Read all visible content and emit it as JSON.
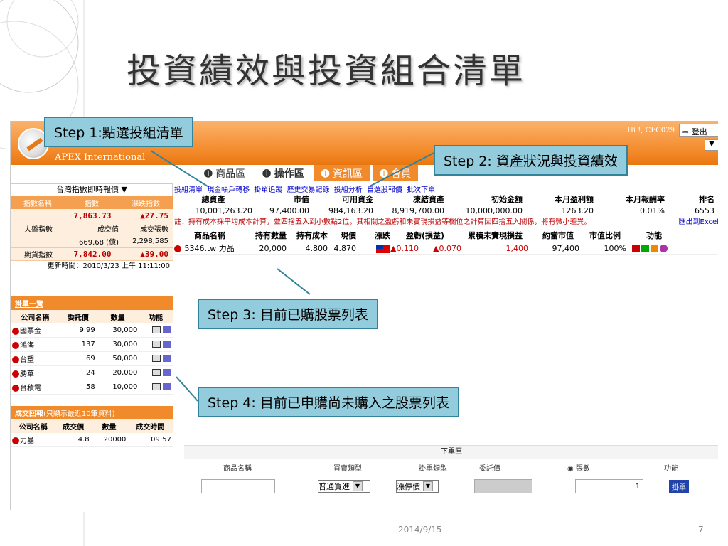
{
  "slide": {
    "title": "投資績效與投資組合清單",
    "date": "2014/9/15",
    "page_number": "7"
  },
  "app": {
    "brand": "APEX International",
    "greeting": "Hi !, CFC029",
    "logout_label": "登出",
    "dropdown_arrow": "▼",
    "nav_tabs": [
      "商品區",
      "操作區",
      "資訊區",
      "會員"
    ],
    "nav_icon": "circle-arrow-icon",
    "accent_color": "#f08a2a"
  },
  "left": {
    "quote_select": "台灣指數即時報價",
    "index_header": [
      "指數名稱",
      "指數",
      "漲跌指數"
    ],
    "market": {
      "name": "大盤指數",
      "index": "7,863.73",
      "change": "▲27.75",
      "volume_label": "成交值",
      "volume": "669.68 (億)",
      "sheets_label": "成交張數",
      "sheets": "2,298,585"
    },
    "futures": {
      "name": "期貨指數",
      "index": "7,842.00",
      "change": "▲39.00"
    },
    "update_time": "更新時間：2010/3/23 上午 11:11:00",
    "pending": {
      "title": "掛單一覽",
      "headers": [
        "公司名稱",
        "委託價",
        "數量",
        "功能"
      ],
      "rows": [
        {
          "name": "國票金",
          "price": "9.99",
          "qty": "30,000"
        },
        {
          "name": "鴻海",
          "price": "137",
          "qty": "30,000"
        },
        {
          "name": "台塑",
          "price": "69",
          "qty": "50,000"
        },
        {
          "name": "勝華",
          "price": "24",
          "qty": "20,000"
        },
        {
          "name": "台積電",
          "price": "58",
          "qty": "10,000"
        }
      ]
    },
    "trades": {
      "title": "成交回報",
      "subtitle": "(只顯示最近10筆資料)",
      "headers": [
        "公司名稱",
        "成交價",
        "數量",
        "成交時間"
      ],
      "rows": [
        {
          "name": "力晶",
          "price": "4.8",
          "qty": "20000",
          "time": "09:57"
        }
      ]
    }
  },
  "main": {
    "links": [
      "投組清單",
      "現金帳戶轉移",
      "掛單追蹤",
      "歷史交易記錄",
      "投組分析",
      "自選股報價",
      "批次下單"
    ],
    "summary_headers": [
      "總資產",
      "市值",
      "可用資金",
      "凍結資產",
      "初始金額",
      "本月盈利額",
      "本月報酬率",
      "排名"
    ],
    "summary_values": [
      "10,001,263.20",
      "97,400.00",
      "984,163.20",
      "8,919,700.00",
      "10,000,000.00",
      "1263.20",
      "0.01%",
      "6553"
    ],
    "note": "註：持有成本採平均成本計算，並四捨五入到小數點2位。其相關之盈虧和未實現損益等欄位之計算因四捨五入關係，將有微小差異。",
    "export_label": "匯出到Excel",
    "holdings_headers": [
      "商品名稱",
      "持有數量",
      "持有成本",
      "現價",
      "漲跌",
      "盈虧(損益)",
      "累積未實現損益",
      "約當市值",
      "市值比例",
      "功能"
    ],
    "holdings": [
      {
        "name": "5346.tw 力晶",
        "qty": "20,000",
        "cost": "4.800",
        "price": "4.870",
        "change": "▲0.110",
        "pnl": "▲0.070",
        "unrealized": "1,400",
        "value": "97,400",
        "ratio": "100%"
      }
    ]
  },
  "order": {
    "title": "下單匣",
    "headers": [
      "商品名稱",
      "買賣類型",
      "掛單類型",
      "委託價",
      "張數",
      "功能"
    ],
    "trade_type": "普通買進",
    "order_type": "漲停價",
    "quantity": "1",
    "submit_label": "掛單"
  },
  "callouts": {
    "step1": "Step 1:點選投組清單",
    "step2": "Step 2: 資產狀況與投資績效",
    "step3": "Step 3: 目前已購股票列表",
    "step4": "Step 4: 目前已申購尚未購入之股票列表"
  }
}
